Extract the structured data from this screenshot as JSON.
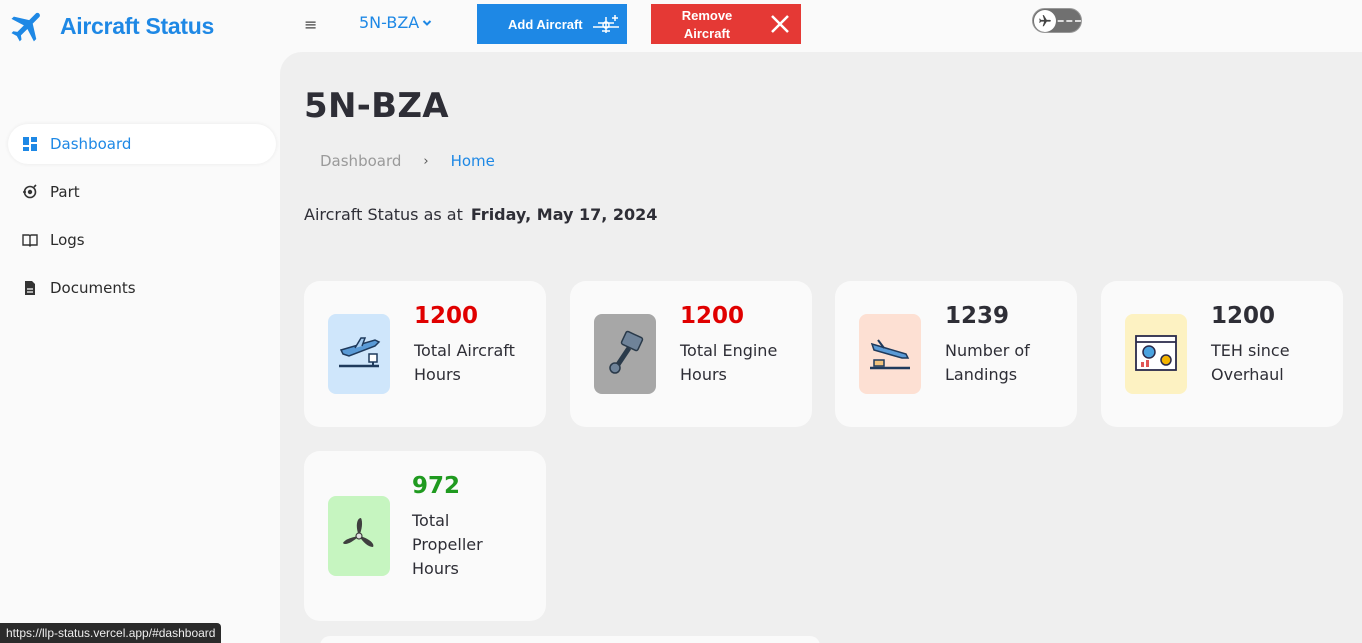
{
  "brand": {
    "title": "Aircraft Status",
    "icon": "airplane-icon",
    "color": "#1e88e5"
  },
  "header": {
    "menu_icon": "≡",
    "aircraft_select": "5N-BZA",
    "add_button": "Add Aircraft",
    "remove_button": "Remove\nAircraft",
    "toggle_icon": "plane-toggle-icon"
  },
  "sidebar": {
    "items": [
      {
        "label": "Dashboard",
        "icon": "dashboard-grid-icon",
        "active": true
      },
      {
        "label": "Part",
        "icon": "part-icon",
        "active": false
      },
      {
        "label": "Logs",
        "icon": "book-icon",
        "active": false
      },
      {
        "label": "Documents",
        "icon": "document-icon",
        "active": false
      }
    ]
  },
  "main": {
    "title": "5N-BZA",
    "breadcrumb": {
      "first": "Dashboard",
      "separator": "›",
      "current": "Home"
    },
    "status_prefix": "Aircraft Status as at",
    "status_date": "Friday, May 17, 2024"
  },
  "cards": [
    {
      "value": "1200",
      "label": "Total Aircraft Hours",
      "value_color": "#e00000",
      "icon": "takeoff-icon",
      "bg": "#cfe6fb"
    },
    {
      "value": "1200",
      "label": "Total Engine Hours",
      "value_color": "#e00000",
      "icon": "engine-piston-icon",
      "bg": "#a7a7a7"
    },
    {
      "value": "1239",
      "label": "Number of Landings",
      "value_color": "#2e2e36",
      "icon": "landing-icon",
      "bg": "#fde0d3"
    },
    {
      "value": "1200",
      "label": "TEH since Overhaul",
      "value_color": "#2e2e36",
      "icon": "dashboard-report-icon",
      "bg": "#fdf2c2"
    },
    {
      "value": "972",
      "label": "Total Propeller Hours",
      "value_color": "#1f9a1f",
      "icon": "propeller-icon",
      "bg": "#c6f5c0"
    }
  ],
  "statusbar": {
    "url": "https://llp-status.vercel.app/#dashboard"
  }
}
